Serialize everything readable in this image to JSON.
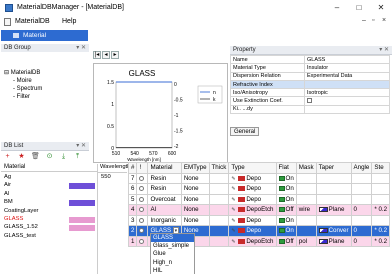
{
  "window": {
    "title": "MaterialDBManager - [MaterialDB]",
    "minimize": "–",
    "maximize": "□",
    "close": "✕"
  },
  "menu": {
    "file": "MaterialDB",
    "help": "Help",
    "mdi_min": "–",
    "mdi_restore": "▫",
    "mdi_close": "×"
  },
  "tab": {
    "label": "Material"
  },
  "panes": {
    "db_group": "DB Group",
    "db_list": "DB List",
    "property": "Property"
  },
  "tree": {
    "root": "MaterialDB",
    "children": [
      "Moire",
      "Spectrum",
      "Filter"
    ]
  },
  "nav": {
    "first": "|◂",
    "prev": "◂",
    "next": "▸"
  },
  "chart_data": {
    "type": "line",
    "title": "GLASS",
    "x": [
      510,
      540,
      570,
      600
    ],
    "xticks": [
      "510",
      "540",
      "570",
      "600"
    ],
    "xlabel": "Wavelength [nm]",
    "ylim_left": [
      0,
      1.5
    ],
    "yticks_left": [
      "0",
      "0.5",
      "1",
      "1.5"
    ],
    "yticks_right": [
      "0",
      "-0.5",
      "-1",
      "-1.5",
      "-2"
    ],
    "series": [
      {
        "name": "n",
        "values": [
          1.5,
          1.5,
          1.5,
          1.5
        ]
      },
      {
        "name": "k",
        "values": [
          0,
          0,
          0,
          0
        ]
      }
    ]
  },
  "property": {
    "rows": [
      {
        "key": "Name",
        "value": "GLASS"
      },
      {
        "key": "Material Type",
        "value": "Insulator"
      },
      {
        "key": "Dispersion Relation",
        "value": "Experimental Data"
      },
      {
        "key": "Refractive Index",
        "value": ""
      },
      {
        "key": "Iso/Anisotropy",
        "value": "Isotropic"
      },
      {
        "key": "Use Extinction Coef.",
        "value": ""
      },
      {
        "key": "Ki.. ...dy",
        "value": ""
      }
    ],
    "general_btn": "General"
  },
  "dblist": {
    "toolbar": [
      "+",
      "★",
      "🗑",
      "⊙",
      "⤓",
      "⤒"
    ],
    "header": "Material",
    "items": [
      {
        "label": "Ag",
        "color": "#ffffff"
      },
      {
        "label": "Air",
        "color": "#6e4fd8"
      },
      {
        "label": "Al",
        "color": "#ffffff"
      },
      {
        "label": "BM",
        "color": "#6e4fd8"
      },
      {
        "label": "CoatingLayer",
        "color": "#ffffff"
      },
      {
        "label": "GLASS",
        "color": "#e79ad0",
        "highlight": true
      },
      {
        "label": "GLASS_1.52",
        "color": "#e79ad0"
      },
      {
        "label": "GLASS_test",
        "color": "#ffffff"
      }
    ],
    "wl_header": "Wavelength",
    "wl_value": "550"
  },
  "layers": {
    "headers": [
      "#",
      "!",
      "Material",
      "EMType",
      "Thick",
      "Type",
      "Flat",
      "Mask",
      "Taper",
      "Angle",
      "Ste"
    ],
    "rows": [
      {
        "idx": "7",
        "mat": "Resin",
        "em": "None",
        "type": "Depo",
        "flat": "On",
        "mask": "",
        "taper": "",
        "angle": "",
        "ste": "",
        "style": ""
      },
      {
        "idx": "6",
        "mat": "Resin",
        "em": "None",
        "type": "Depo",
        "flat": "On",
        "mask": "",
        "taper": "",
        "angle": "",
        "ste": "",
        "style": ""
      },
      {
        "idx": "5",
        "mat": "Overcoat",
        "em": "None",
        "type": "Depo",
        "flat": "On",
        "mask": "",
        "taper": "",
        "angle": "",
        "ste": "",
        "style": ""
      },
      {
        "idx": "4",
        "mat": "Al",
        "em": "None",
        "type": "DepoEtch",
        "flat": "Off",
        "mask": "wire",
        "taper": "Plane",
        "angle": "0",
        "ste": "* 0.2",
        "style": "pink"
      },
      {
        "idx": "3",
        "mat": "Inorganic",
        "em": "None",
        "type": "Depo",
        "flat": "On",
        "mask": "",
        "taper": "",
        "angle": "",
        "ste": "",
        "style": ""
      },
      {
        "idx": "2",
        "mat": "GLASS",
        "em": "None",
        "type": "Depo",
        "flat": "On",
        "mask": "",
        "taper": "Conver",
        "angle": "0",
        "ste": "* 0.2",
        "style": "sel"
      },
      {
        "idx": "1",
        "mat": "",
        "em": "",
        "type": "DepoEtch",
        "flat": "Off",
        "mask": "pol",
        "taper": "Plane",
        "angle": "0",
        "ste": "* 0.2",
        "style": "pink"
      }
    ]
  },
  "dropdown": {
    "options": [
      "GLASS",
      "Glass_simple",
      "Glue",
      "High_n",
      "HIL"
    ]
  }
}
